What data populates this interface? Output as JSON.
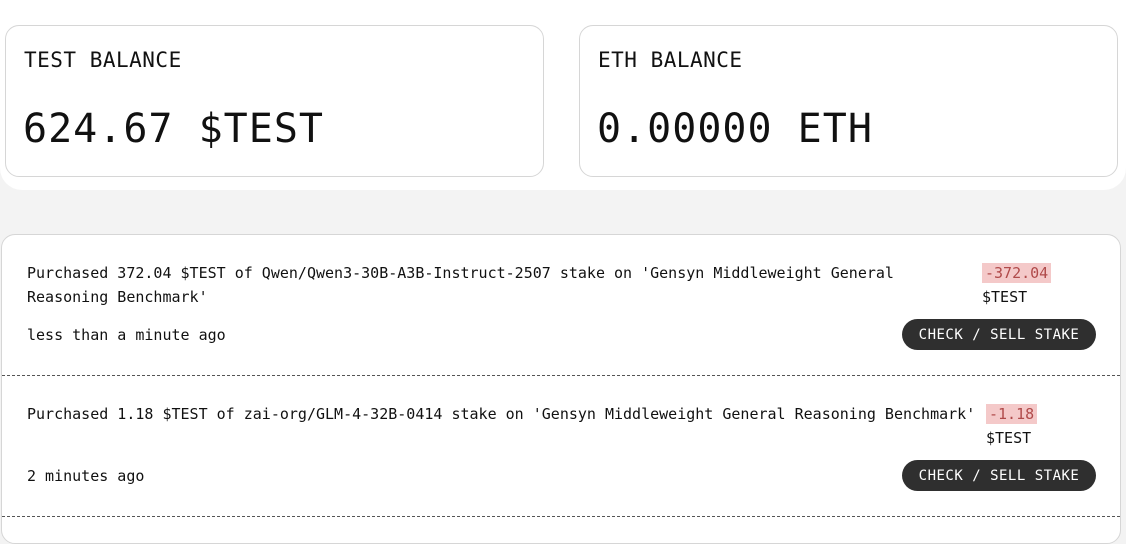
{
  "balances": {
    "test": {
      "label": "TEST BALANCE",
      "value": "624.67 $TEST"
    },
    "eth": {
      "label": "ETH BALANCE",
      "value": "0.00000 ETH"
    }
  },
  "transactions": [
    {
      "description": "Purchased 372.04 $TEST of Qwen/Qwen3-30B-A3B-Instruct-2507 stake on 'Gensyn Middleweight General Reasoning Benchmark'",
      "amount": "-372.04",
      "unit": "$TEST",
      "time": "less than a minute ago",
      "action_label": "CHECK / SELL STAKE"
    },
    {
      "description": "Purchased 1.18 $TEST of zai-org/GLM-4-32B-0414 stake on 'Gensyn Middleweight General Reasoning Benchmark'",
      "amount": "-1.18",
      "unit": "$TEST",
      "time": "2 minutes ago",
      "action_label": "CHECK / SELL STAKE"
    }
  ],
  "colors": {
    "negative_bg": "#f4c9c9",
    "negative_text": "#b04a4a",
    "button_bg": "#2f2f2f"
  }
}
